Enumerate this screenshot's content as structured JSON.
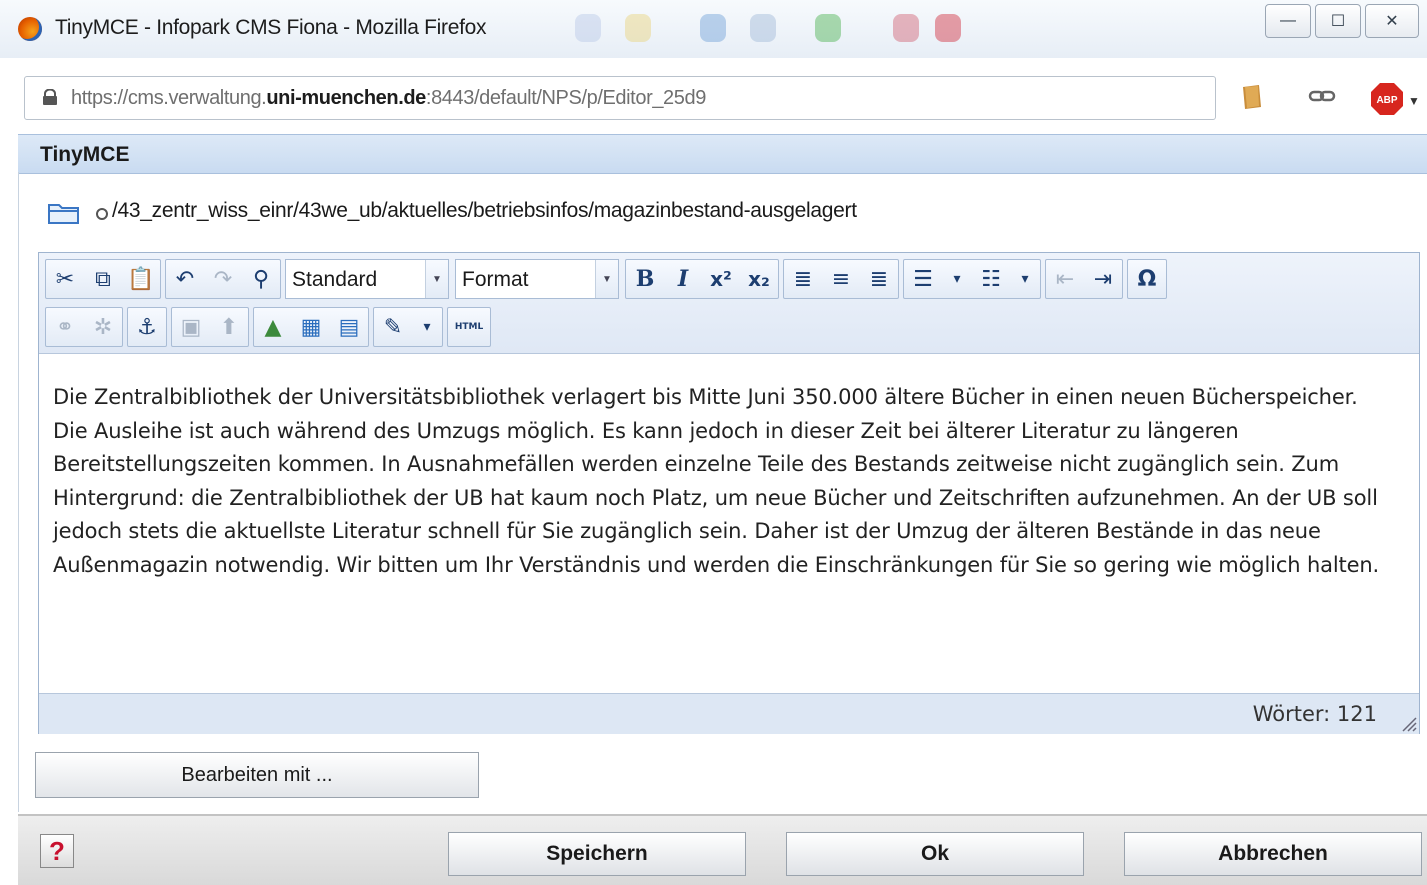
{
  "window": {
    "title": "TinyMCE - Infopark CMS Fiona - Mozilla Firefox",
    "minimize_symbol": "—",
    "maximize_symbol": "☐",
    "close_symbol": "✕"
  },
  "browser": {
    "url_prefix": "https://cms.verwaltung.",
    "url_domain": "uni-muenchen.de",
    "url_suffix": ":8443/default/NPS/p/Editor_25d9",
    "abp_label": "ABP"
  },
  "dialog": {
    "title": "TinyMCE",
    "path": "/43_zentr_wiss_einr/43we_ub/aktuelles/betriebsinfos/magazinbestand-ausgelagert"
  },
  "toolbar": {
    "style_select": "Standard",
    "format_select": "Format",
    "html_label": "HTML"
  },
  "editor": {
    "content": "Die Zentralbibliothek der Universitätsbibliothek verlagert bis Mitte Juni 350.000 ältere Bücher in einen neuen Bücherspeicher. Die Ausleihe ist auch während des Umzugs möglich. Es kann jedoch in dieser Zeit bei älterer Literatur zu längeren Bereitstellungszeiten kommen. In Ausnahmefällen werden einzelne Teile des Bestands zeitweise nicht zugänglich sein. Zum Hintergrund: die Zentralbibliothek der UB hat kaum noch Platz, um neue Bücher und Zeitschriften aufzunehmen. An der UB soll jedoch stets die aktuellste Literatur schnell für Sie zugänglich sein. Daher ist der Umzug der älteren Bestände in das neue Außenmagazin notwendig. Wir bitten um Ihr Verständnis und werden die Einschränkungen für Sie so gering wie möglich halten.",
    "word_count": "Wörter: 121"
  },
  "buttons": {
    "edit_with": "Bearbeiten mit ...",
    "save": "Speichern",
    "ok": "Ok",
    "cancel": "Abbrechen",
    "help": "?"
  },
  "colors": {
    "header_bg": "#c9dbf1",
    "toolbar_bg": "#dfe8f5",
    "icon_blue": "#1d3e70",
    "help_red": "#c8102e",
    "abp_red": "#d7261e"
  }
}
